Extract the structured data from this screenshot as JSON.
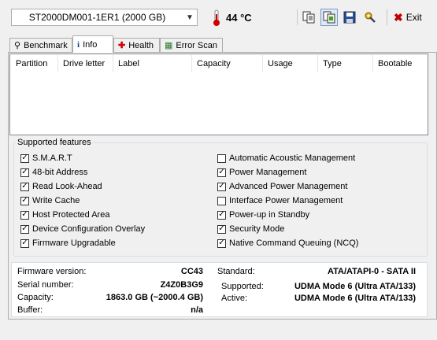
{
  "toolbar": {
    "drive": "ST2000DM001-1ER1 (2000 GB)",
    "temperature": "44 °C",
    "exit_label": "Exit"
  },
  "tabs": [
    {
      "label": "Benchmark",
      "icon": "gauge-icon"
    },
    {
      "label": "Info",
      "icon": "info-icon"
    },
    {
      "label": "Health",
      "icon": "health-cross-icon"
    },
    {
      "label": "Error Scan",
      "icon": "error-scan-icon"
    }
  ],
  "partition_table": {
    "columns": [
      "Partition",
      "Drive letter",
      "Label",
      "Capacity",
      "Usage",
      "Type",
      "Bootable"
    ],
    "rows": []
  },
  "features": {
    "title": "Supported features",
    "left": [
      {
        "label": "S.M.A.R.T",
        "checked": true
      },
      {
        "label": "48-bit Address",
        "checked": true
      },
      {
        "label": "Read Look-Ahead",
        "checked": true
      },
      {
        "label": "Write Cache",
        "checked": true
      },
      {
        "label": "Host Protected Area",
        "checked": true
      },
      {
        "label": "Device Configuration Overlay",
        "checked": true
      },
      {
        "label": "Firmware Upgradable",
        "checked": true
      }
    ],
    "right": [
      {
        "label": "Automatic Acoustic Management",
        "checked": false
      },
      {
        "label": "Power Management",
        "checked": true
      },
      {
        "label": "Advanced Power Management",
        "checked": true
      },
      {
        "label": "Interface Power Management",
        "checked": false
      },
      {
        "label": "Power-up in Standby",
        "checked": true
      },
      {
        "label": "Security Mode",
        "checked": true
      },
      {
        "label": "Native Command Queuing (NCQ)",
        "checked": true
      }
    ]
  },
  "info": {
    "firmware_label": "Firmware version:",
    "firmware": "CC43",
    "serial_label": "Serial number:",
    "serial": "Z4Z0B3G9",
    "capacity_label": "Capacity:",
    "capacity": "1863.0 GB (~2000.4 GB)",
    "buffer_label": "Buffer:",
    "buffer": "n/a",
    "standard_label": "Standard:",
    "standard": "ATA/ATAPI-0 - SATA II",
    "supported_label": "Supported:",
    "supported": "UDMA Mode 6 (Ultra ATA/133)",
    "active_label": "Active:",
    "active": "UDMA Mode 6 (Ultra ATA/133)"
  }
}
